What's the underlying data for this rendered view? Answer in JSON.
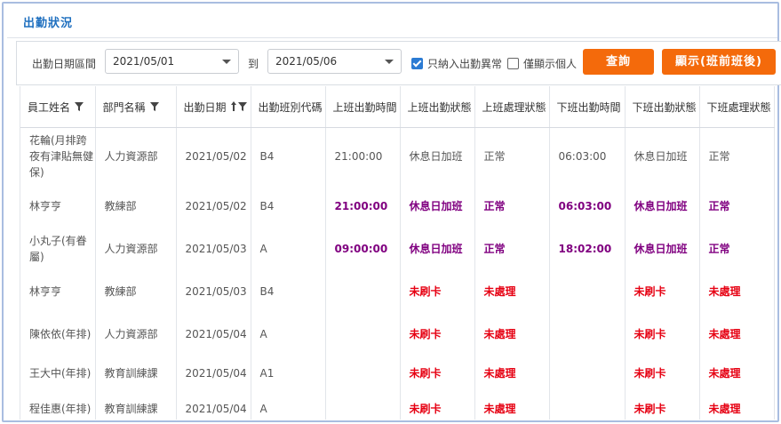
{
  "header": {
    "title": "出勤狀況"
  },
  "filter": {
    "date_range_label": "出勤日期區間",
    "start_date": "2021/05/01",
    "to_label": "到",
    "end_date": "2021/05/06",
    "only_abnormal_label": "只納入出勤異常",
    "only_abnormal_checked": true,
    "only_personal_label": "僅顯示個人",
    "only_personal_checked": false,
    "query_button": "查詢",
    "show_button": "顯示(班前班後)"
  },
  "table": {
    "columns": [
      {
        "label": "員工姓名",
        "icon": "filter-icon"
      },
      {
        "label": "部門名稱",
        "icon": "filter-icon"
      },
      {
        "label": "出勤日期",
        "icon": "sort-asc-filter-icon"
      },
      {
        "label": "出勤班別代碼"
      },
      {
        "label": "上班出勤時間"
      },
      {
        "label": "上班出勤狀態"
      },
      {
        "label": "上班處理狀態"
      },
      {
        "label": "下班出勤時間"
      },
      {
        "label": "下班出勤狀態"
      },
      {
        "label": "下班處理狀態"
      }
    ],
    "rows": [
      {
        "name": "花輪(月排跨夜有津貼無健保)",
        "dept": "人力資源部",
        "date": "2021/05/02",
        "shift": "B4",
        "in_time": "21:00:00",
        "in_status": "休息日加班",
        "in_proc": "正常",
        "out_time": "06:03:00",
        "out_status": "休息日加班",
        "out_proc": "正常",
        "style": "normal"
      },
      {
        "name": "林亨亨",
        "dept": "教練部",
        "date": "2021/05/02",
        "shift": "B4",
        "in_time": "21:00:00",
        "in_status": "休息日加班",
        "in_proc": "正常",
        "out_time": "06:03:00",
        "out_status": "休息日加班",
        "out_proc": "正常",
        "style": "purple"
      },
      {
        "name": "小丸子(有眷屬)",
        "dept": "人力資源部",
        "date": "2021/05/03",
        "shift": "A",
        "in_time": "09:00:00",
        "in_status": "休息日加班",
        "in_proc": "正常",
        "out_time": "18:02:00",
        "out_status": "休息日加班",
        "out_proc": "正常",
        "style": "purple"
      },
      {
        "name": "林亨亨",
        "dept": "教練部",
        "date": "2021/05/03",
        "shift": "B4",
        "in_time": "",
        "in_status": "未刷卡",
        "in_proc": "未處理",
        "out_time": "",
        "out_status": "未刷卡",
        "out_proc": "未處理",
        "style": "red"
      },
      {
        "name": "陳依依(年排)",
        "dept": "人力資源部",
        "date": "2021/05/04",
        "shift": "A",
        "in_time": "",
        "in_status": "未刷卡",
        "in_proc": "未處理",
        "out_time": "",
        "out_status": "未刷卡",
        "out_proc": "未處理",
        "style": "red"
      },
      {
        "name": "王大中(年排)",
        "dept": "教育訓練課",
        "date": "2021/05/04",
        "shift": "A1",
        "in_time": "",
        "in_status": "未刷卡",
        "in_proc": "未處理",
        "out_time": "",
        "out_status": "未刷卡",
        "out_proc": "未處理",
        "style": "red"
      },
      {
        "name": "程佳惠(年排)",
        "dept": "教育訓練課",
        "date": "2021/05/04",
        "shift": "A",
        "in_time": "",
        "in_status": "未刷卡",
        "in_proc": "未處理",
        "out_time": "",
        "out_status": "未刷卡",
        "out_proc": "未處理",
        "style": "red"
      }
    ]
  },
  "colors": {
    "title": "#1e6fbf",
    "button": "#f46a0b",
    "purple_text": "#800080",
    "red_text": "#e60012",
    "frame_border": "#a9bde0"
  }
}
